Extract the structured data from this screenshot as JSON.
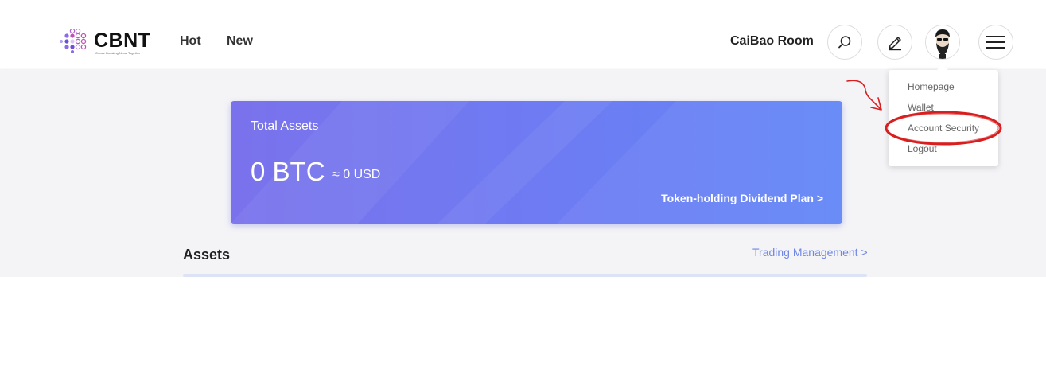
{
  "header": {
    "logo": {
      "word": "CBNT",
      "tagline": "Create Breaking News Together",
      "brand_color": "#6b4fd8"
    },
    "nav": [
      {
        "label": "Hot"
      },
      {
        "label": "New"
      }
    ],
    "room_label": "CaiBao Room",
    "icons": {
      "search": "search-icon",
      "write": "pencil-icon",
      "avatar": "avatar",
      "menu": "hamburger-menu-icon"
    }
  },
  "dropdown": {
    "items": [
      {
        "label": "Homepage"
      },
      {
        "label": "Wallet"
      },
      {
        "label": "Account Security"
      },
      {
        "label": "Logout"
      }
    ]
  },
  "assets_card": {
    "title": "Total Assets",
    "btc_value": "0 BTC",
    "usd_value": "≈ 0 USD",
    "plan_link": "Token-holding Dividend Plan >",
    "gradient_colors": [
      "#7a72ec",
      "#6386f7"
    ]
  },
  "assets_section": {
    "title": "Assets",
    "trading_link": "Trading Management >",
    "link_color": "#6f86e6"
  },
  "annotation": {
    "color": "#d81e1e",
    "target": "Account Security"
  }
}
